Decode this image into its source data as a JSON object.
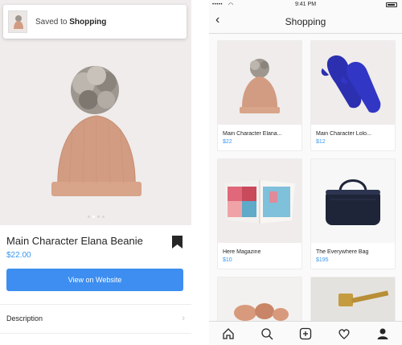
{
  "left": {
    "toast": {
      "prefix": "Saved to",
      "collection": "Shopping"
    },
    "product": {
      "title": "Main Character Elana Beanie",
      "price": "$22.00"
    },
    "view_button": "View on Website",
    "description_label": "Description",
    "carousel": {
      "count": 4,
      "active_index": 1
    },
    "icons": [
      "bookmark-filled-icon",
      "chevron-right-icon"
    ]
  },
  "right": {
    "status": {
      "time": "9:41 PM",
      "signal": "•••••",
      "wifi": "◠"
    },
    "nav": {
      "title": "Shopping",
      "back_icon": "chevron-left-icon"
    },
    "items": [
      {
        "name": "Main Character Elana...",
        "price": "$22"
      },
      {
        "name": "Main Character Lolo...",
        "price": "$12"
      },
      {
        "name": "Here Magazine",
        "price": "$10"
      },
      {
        "name": "The Everywhere Bag",
        "price": "$195"
      }
    ],
    "tabs": [
      "home-icon",
      "search-icon",
      "add-post-icon",
      "heart-icon",
      "profile-icon"
    ]
  },
  "colors": {
    "accent": "#3897f0",
    "button": "#3d8ef0",
    "beanie": "#d9a187",
    "mittens": "#2b2fb0",
    "bag": "#1f2538"
  }
}
